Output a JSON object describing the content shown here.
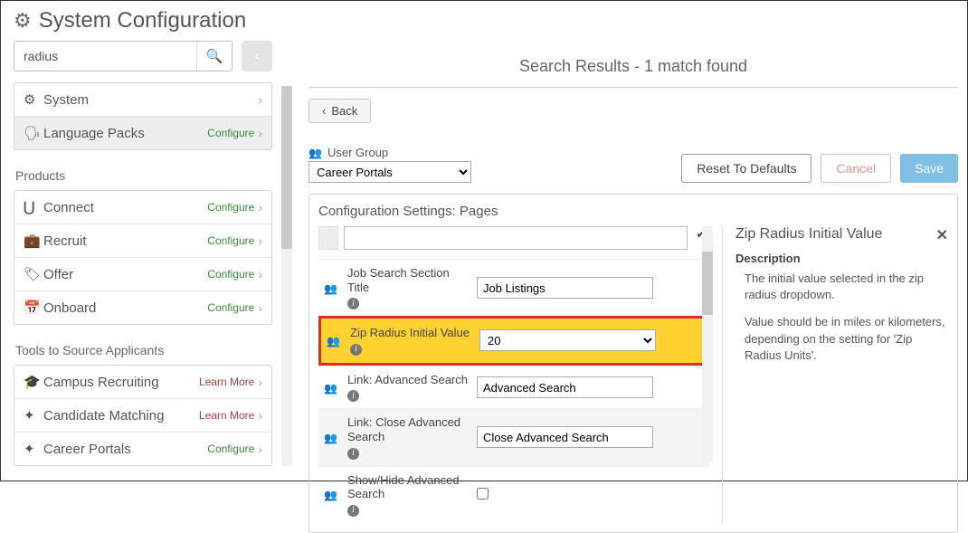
{
  "header": {
    "title": "System Configuration"
  },
  "search": {
    "value": "radius"
  },
  "sidebar": {
    "group1": [
      {
        "icon": "⚙",
        "label": "System",
        "link": "",
        "link_type": ""
      },
      {
        "icon": "🗣",
        "label": "Language Packs",
        "link": "Configure",
        "link_type": "configure"
      }
    ],
    "products_title": "Products",
    "products": [
      {
        "icon": "⋃",
        "label": "Connect",
        "link": "Configure",
        "link_type": "configure"
      },
      {
        "icon": "💼",
        "label": "Recruit",
        "link": "Configure",
        "link_type": "configure"
      },
      {
        "icon": "🏷",
        "label": "Offer",
        "link": "Configure",
        "link_type": "configure"
      },
      {
        "icon": "📅",
        "label": "Onboard",
        "link": "Configure",
        "link_type": "configure"
      }
    ],
    "tools_title": "Tools to Source Applicants",
    "tools": [
      {
        "icon": "🎓",
        "label": "Campus Recruiting",
        "link": "Learn More",
        "link_type": "learn"
      },
      {
        "icon": "✦",
        "label": "Candidate Matching",
        "link": "Learn More",
        "link_type": "learn"
      },
      {
        "icon": "✦",
        "label": "Career Portals",
        "link": "Configure",
        "link_type": "configure"
      }
    ]
  },
  "main": {
    "results_title": "Search Results - 1 match found",
    "back_label": "Back",
    "user_group_label": "User Group",
    "user_group_value": "Career Portals",
    "buttons": {
      "reset": "Reset To Defaults",
      "cancel": "Cancel",
      "save": "Save"
    },
    "settings_title": "Configuration Settings: Pages",
    "rows": [
      {
        "label": "Job Search Section Title",
        "value": "Job Listings",
        "type": "text"
      },
      {
        "label": "Zip Radius Initial Value",
        "value": "20",
        "type": "select"
      },
      {
        "label": "Link: Advanced Search",
        "value": "Advanced Search",
        "type": "text"
      },
      {
        "label": "Link: Close Advanced Search",
        "value": "Close Advanced Search",
        "type": "text"
      },
      {
        "label": "Show/Hide Advanced Search",
        "value": "",
        "type": "checkbox"
      }
    ],
    "detail": {
      "title": "Zip Radius Initial Value",
      "sub": "Description",
      "p1": "The initial value selected in the zip radius dropdown.",
      "p2": "Value should be in miles or kilometers, depending on the setting for 'Zip Radius Units'."
    }
  }
}
